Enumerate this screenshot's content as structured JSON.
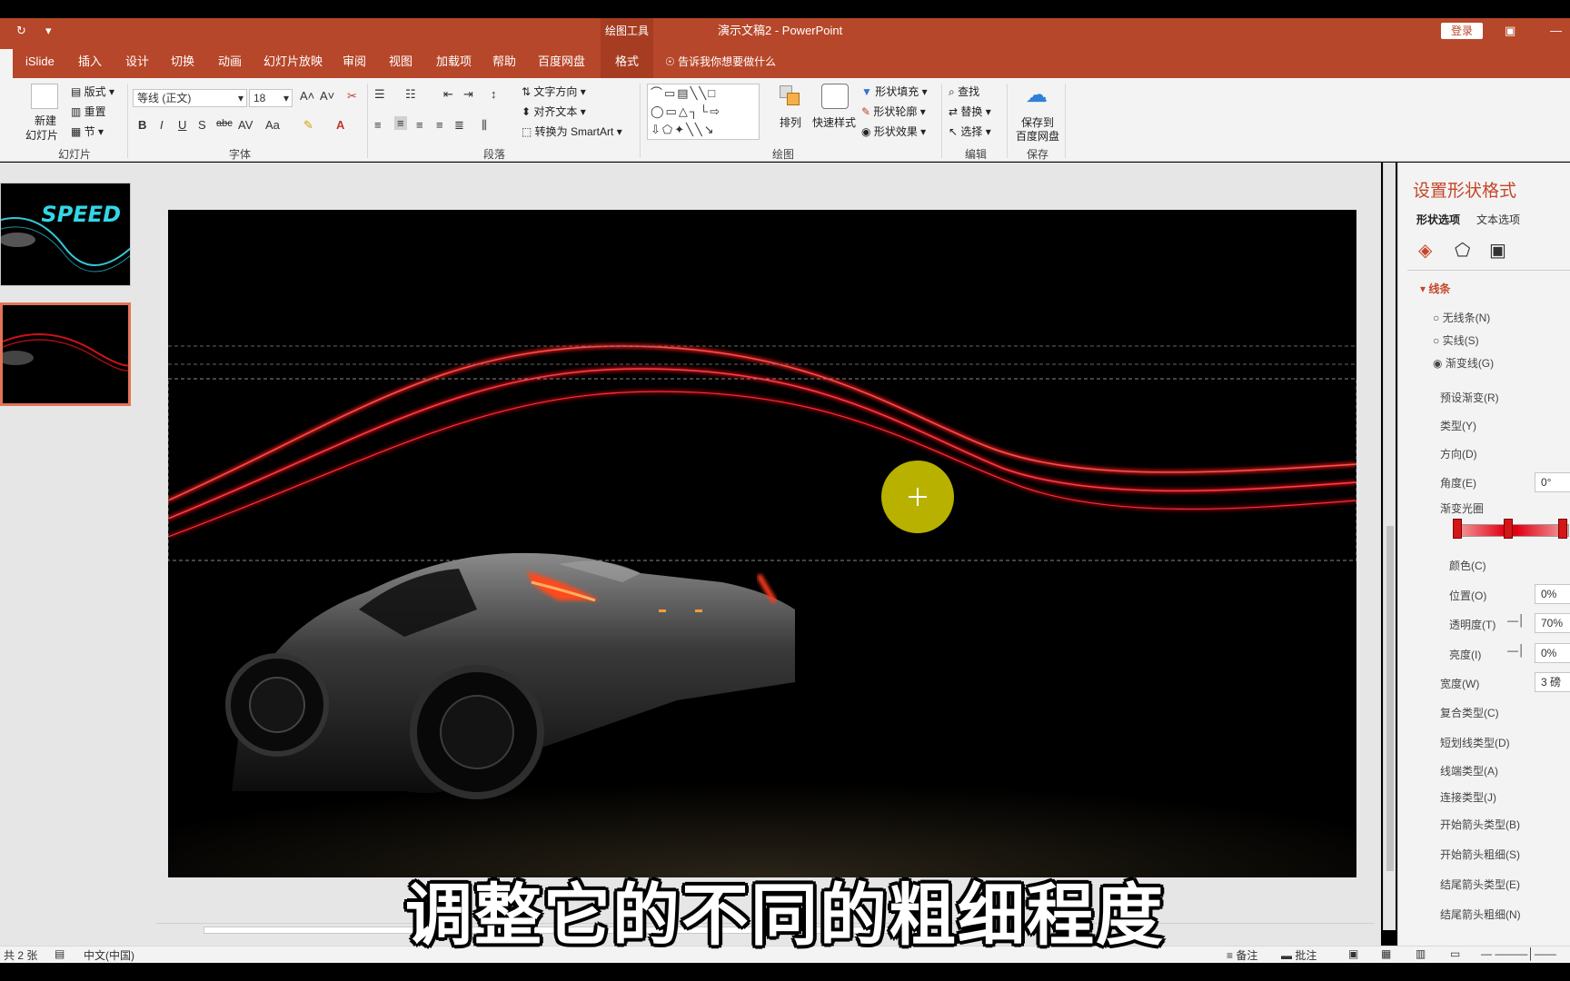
{
  "window": {
    "drawing_tools_label": "绘图工具",
    "doc_title": "演示文稿2 - PowerPoint",
    "login_label": "登录"
  },
  "tabs": [
    {
      "label": "iSlide"
    },
    {
      "label": "插入"
    },
    {
      "label": "设计"
    },
    {
      "label": "切换"
    },
    {
      "label": "动画"
    },
    {
      "label": "幻灯片放映"
    },
    {
      "label": "审阅"
    },
    {
      "label": "视图"
    },
    {
      "label": "加载项"
    },
    {
      "label": "帮助"
    },
    {
      "label": "百度网盘"
    },
    {
      "label": "格式"
    }
  ],
  "tell_me": "告诉我你想要做什么",
  "ribbon": {
    "slides_group": {
      "label": "幻灯片",
      "new_slide": "新建",
      "new_slide2": "幻灯片",
      "layout": "版式",
      "reset": "重置",
      "section": "节"
    },
    "font_group": {
      "label": "字体",
      "font_name": "等线 (正文)",
      "font_size": "18"
    },
    "paragraph_group": {
      "label": "段落",
      "text_direction": "文字方向",
      "align_text": "对齐文本",
      "convert_smartart": "转换为 SmartArt"
    },
    "drawing_group": {
      "label": "绘图",
      "arrange": "排列",
      "quick_styles": "快速样式",
      "shape_fill": "形状填充",
      "shape_outline": "形状轮廓",
      "shape_effects": "形状效果"
    },
    "editing_group": {
      "label": "编辑",
      "find": "查找",
      "replace": "替换",
      "select": "选择"
    },
    "save_group": {
      "label": "保存",
      "save_to": "保存到",
      "baidu": "百度网盘"
    }
  },
  "thumbs": {
    "speed_text": "SPEED"
  },
  "format_pane": {
    "title": "设置形状格式",
    "tab_shape": "形状选项",
    "tab_text": "文本选项",
    "section_line": "线条",
    "radio_none": "无线条(N)",
    "radio_solid": "实线(S)",
    "radio_gradient": "渐变线(G)",
    "preset_gradient": "预设渐变(R)",
    "type": "类型(Y)",
    "direction": "方向(D)",
    "angle": "角度(E)",
    "angle_value": "0°",
    "gradient_stops": "渐变光圈",
    "color": "颜色(C)",
    "position": "位置(O)",
    "position_value": "0%",
    "transparency": "透明度(T)",
    "transparency_value": "70%",
    "brightness": "亮度(I)",
    "brightness_value": "0%",
    "width": "宽度(W)",
    "width_value": "3 磅",
    "compound_type": "复合类型(C)",
    "dash_type": "短划线类型(D)",
    "cap_type": "线端类型(A)",
    "join_type": "连接类型(J)",
    "begin_arrow_type": "开始箭头类型(B)",
    "begin_arrow_size": "开始箭头粗细(S)",
    "end_arrow_type": "结尾箭头类型(E)",
    "end_arrow_size": "结尾箭头粗细(N)"
  },
  "status": {
    "slide_count": "共 2 张",
    "language": "中文(中国)",
    "notes": "备注",
    "comments": "批注"
  },
  "subtitle": "调整它的不同的粗细程度",
  "colors": {
    "accent": "#b7472a",
    "accent_dark": "#a63d22",
    "pane_title": "#c5472a",
    "light_trail": "#e0101a",
    "cursor_highlight": "#d8d000"
  }
}
